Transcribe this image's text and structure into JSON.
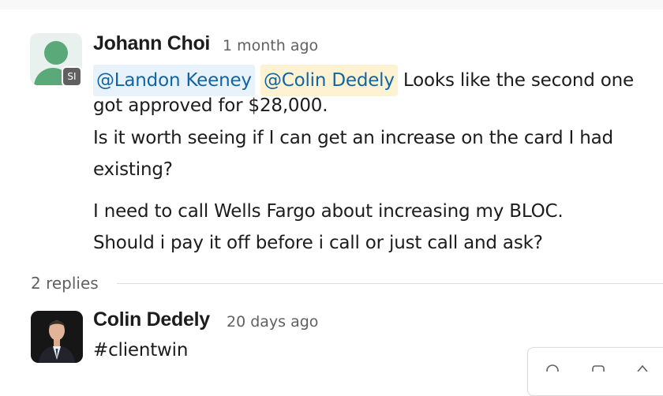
{
  "message": {
    "avatar": {
      "icon": "person-icon",
      "color": "#5aa978"
    },
    "badge": "SI",
    "author": "Johann Choi",
    "time": "1 month ago",
    "mention1": "@Landon Keeney",
    "mention2": "@Colin Dedely",
    "line1_tail": "Looks like the second one",
    "line2": "got approved for $28,000.",
    "line3": "Is it worth seeing if I can get an increase on the card I had",
    "line4": "existing?",
    "line5": "I need to call Wells Fargo about increasing my BLOC.",
    "line6": "Should i pay it off before i call or just call and ask?"
  },
  "thread": {
    "replies_label": "2 replies"
  },
  "reply": {
    "author": "Colin Dedely",
    "time": "20 days ago",
    "text": "#clientwin"
  },
  "colors": {
    "mention_text": "#1264a3",
    "mention_bg_1": "#e8f2fa",
    "mention_bg_2": "#fdf3d3"
  }
}
